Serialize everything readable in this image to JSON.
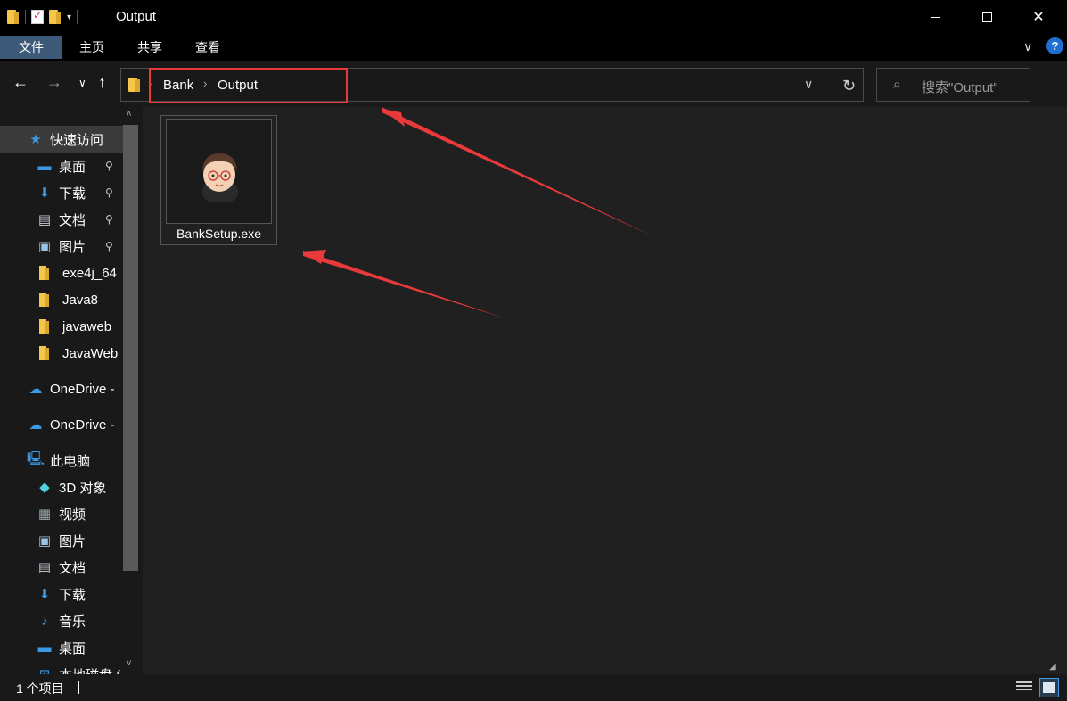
{
  "window": {
    "title": "Output",
    "minimize_icon": "minimize-icon",
    "maximize_icon": "maximize-icon",
    "close_label": "✕"
  },
  "ribbon": {
    "tabs": [
      {
        "label": "文件"
      },
      {
        "label": "主页"
      },
      {
        "label": "共享"
      },
      {
        "label": "查看"
      }
    ],
    "help_label": "?"
  },
  "nav": {
    "breadcrumb": [
      "Bank",
      "Output"
    ],
    "search_placeholder": "搜索\"Output\""
  },
  "sidebar": {
    "quick_access": "快速访问",
    "quick_items": [
      {
        "label": "桌面",
        "pinned": true,
        "icon": "desktop-icon"
      },
      {
        "label": "下载",
        "pinned": true,
        "icon": "download-icon"
      },
      {
        "label": "文档",
        "pinned": true,
        "icon": "document-icon"
      },
      {
        "label": "图片",
        "pinned": true,
        "icon": "pictures-icon"
      },
      {
        "label": "exe4j_64",
        "pinned": false,
        "icon": "folder-icon"
      },
      {
        "label": "Java8",
        "pinned": false,
        "icon": "folder-icon"
      },
      {
        "label": "javaweb",
        "pinned": false,
        "icon": "folder-icon"
      },
      {
        "label": "JavaWeb",
        "pinned": false,
        "icon": "folder-icon"
      }
    ],
    "onedrive_1": "OneDrive -",
    "onedrive_2": "OneDrive -",
    "this_pc": "此电脑",
    "pc_items": [
      {
        "label": "3D 对象",
        "icon": "3d-objects-icon"
      },
      {
        "label": "视频",
        "icon": "videos-icon"
      },
      {
        "label": "图片",
        "icon": "pictures-icon"
      },
      {
        "label": "文档",
        "icon": "document-icon"
      },
      {
        "label": "下载",
        "icon": "download-icon"
      },
      {
        "label": "音乐",
        "icon": "music-icon"
      },
      {
        "label": "桌面",
        "icon": "desktop-icon"
      },
      {
        "label": "本地磁盘 (",
        "icon": "drive-icon"
      }
    ]
  },
  "files": [
    {
      "name": "BankSetup.exe",
      "icon": "avatar-icon"
    }
  ],
  "status": {
    "count": "1 个项目"
  },
  "colors": {
    "accent": "#3c5a78",
    "highlight_red": "#e83a3a",
    "folder_yellow": "#f5c648"
  }
}
